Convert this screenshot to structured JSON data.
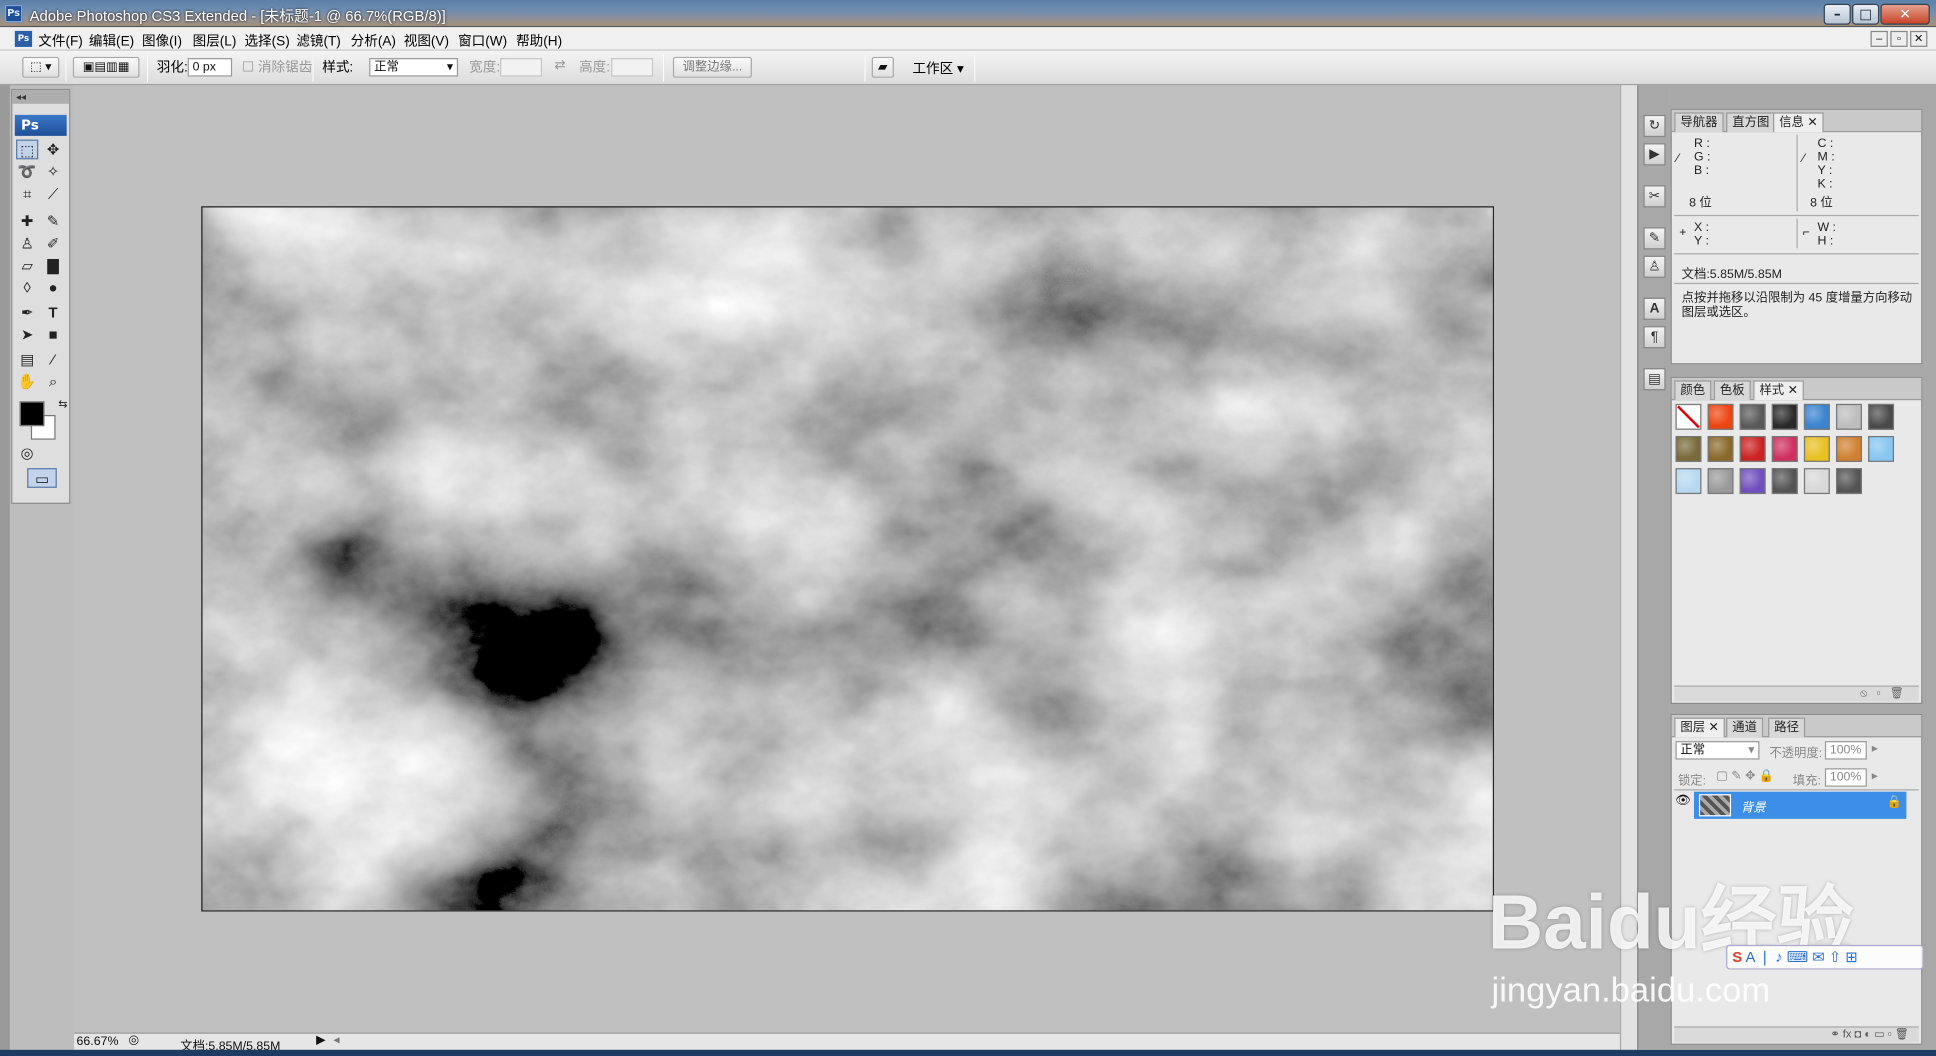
{
  "window": {
    "title": "Adobe Photoshop CS3 Extended - [未标题-1 @ 66.7%(RGB/8)]",
    "app_badge": "Ps"
  },
  "menu": [
    "文件(F)",
    "编辑(E)",
    "图像(I)",
    "图层(L)",
    "选择(S)",
    "滤镜(T)",
    "分析(A)",
    "视图(V)",
    "窗口(W)",
    "帮助(H)"
  ],
  "options": {
    "feather_label": "羽化:",
    "feather_value": "0 px",
    "antialias_label": "消除锯齿",
    "style_label": "样式:",
    "style_value": "正常",
    "width_label": "宽度:",
    "height_label": "高度:",
    "refine_button": "调整边缘...",
    "workspace_button": "工作区 ▾"
  },
  "toolbox": {
    "badge": "Ps"
  },
  "status": {
    "zoom": "66.67%",
    "doc": "文档:5.85M/5.85M"
  },
  "info_panel": {
    "tabs": [
      "导航器",
      "直方图",
      "信息"
    ],
    "rgb_labels": [
      "R :",
      "G :",
      "B :"
    ],
    "cmyk_labels": [
      "C :",
      "M :",
      "Y :",
      "K :"
    ],
    "bits_left": "8 位",
    "bits_right": "8 位",
    "xy_labels": [
      "X :",
      "Y :"
    ],
    "wh_labels": [
      "W :",
      "H :"
    ],
    "doc": "文档:5.85M/5.85M",
    "hint": "点按并拖移以沿限制为 45 度增量方向移动图层或选区。"
  },
  "styles_panel": {
    "tabs": [
      "颜色",
      "色板",
      "样式"
    ],
    "swatches": [
      "#ffffff",
      "#ee4411",
      "#5a5a5a",
      "#2a2a2a",
      "#3a84d0",
      "#bdbdbd",
      "#4a4a4a",
      "#7a6a3a",
      "#8a6a2a",
      "#cc2222",
      "#d03060",
      "#e8c020",
      "#d08030",
      "#86c6f0",
      "#b8d8f0",
      "#9a9a9a",
      "#7050c0",
      "#555555",
      "#d8d8d8",
      "#555555"
    ]
  },
  "layers_panel": {
    "tabs": [
      "图层",
      "通道",
      "路径"
    ],
    "blend_mode": "正常",
    "opacity_label": "不透明度:",
    "opacity_value": "100%",
    "lock_label": "锁定:",
    "fill_label": "填充:",
    "fill_value": "100%",
    "layer_name": "背景"
  },
  "watermark": {
    "brand": "Baidu经验",
    "url": "jingyan.baidu.com"
  },
  "colors": {
    "selection_blue": "#3d8ee6",
    "workspace_gray": "#c0c0c0"
  }
}
